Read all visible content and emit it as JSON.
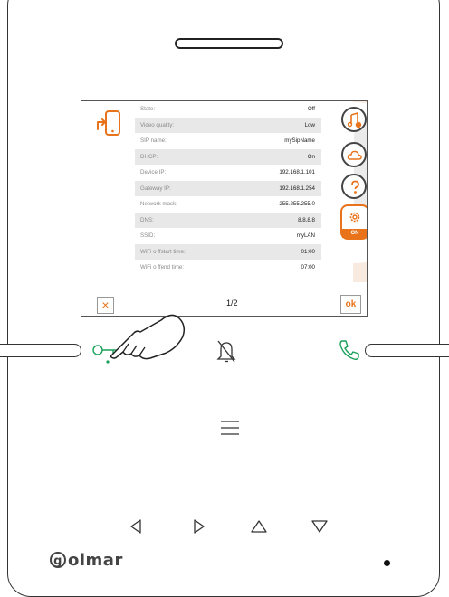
{
  "settings": {
    "rows": [
      {
        "label": "State:",
        "value": "Off"
      },
      {
        "label": "Video quality:",
        "value": "Low"
      },
      {
        "label": "SIP name:",
        "value": "mySipName"
      },
      {
        "label": "DHCP:",
        "value": "On"
      },
      {
        "label": "Device IP:",
        "value": "192.168.1.101"
      },
      {
        "label": "Gateway IP:",
        "value": "192.168.1.254"
      },
      {
        "label": "Network mask:",
        "value": "255.255.255.0"
      },
      {
        "label": "DNS:",
        "value": "8.8.8.8"
      },
      {
        "label": "SSID:",
        "value": "myLAN"
      },
      {
        "label": "WiFi o ffstart time:",
        "value": "01:00"
      },
      {
        "label": "WiFi o ffend time:",
        "value": "07:00"
      }
    ],
    "page": "1/2"
  },
  "buttons": {
    "cancel_label": "×",
    "ok_label": "ok",
    "on_label": "ON"
  },
  "brand": {
    "logo_letter": "g",
    "name": "olmar"
  },
  "colors": {
    "accent": "#e8731a",
    "call_green": "#1aa05a"
  },
  "icons": {
    "screen_header": "phone-transfer-icon",
    "side": [
      "ringtone-settings-icon",
      "cloud-icon",
      "help-icon",
      "settings-gear-icon"
    ],
    "hardware": [
      "door-key-icon",
      "mute-bell-icon",
      "answer-call-icon",
      "menu-icon",
      "left-arrow-icon",
      "right-arrow-icon",
      "up-arrow-icon",
      "down-arrow-icon"
    ]
  }
}
